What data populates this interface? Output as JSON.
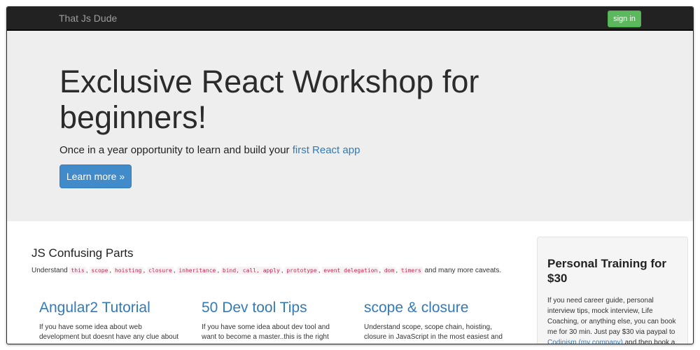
{
  "navbar": {
    "brand": "That Js Dude",
    "signin_label": "sign in"
  },
  "hero": {
    "title": "Exclusive React Workshop for beginners!",
    "subtitle_prefix": "Once in a year opportunity to learn and build your ",
    "subtitle_link": "first React app",
    "button_label": "Learn more »"
  },
  "main": {
    "section_title": "JS Confusing Parts",
    "topics_prefix": "Understand",
    "topics": [
      "this",
      "scope",
      "hoisting",
      "closure",
      "inheritance",
      "bind, call, apply",
      "prototype",
      "event delegation",
      "dom",
      "timers"
    ],
    "topics_separator": ",",
    "topics_suffix": "and many more caveats.",
    "cards": [
      {
        "title": "Angular2 Tutorial",
        "text": "If you have some idea about web development but doesnt have any clue about"
      },
      {
        "title": "50 Dev tool Tips",
        "text": "If you have some idea about dev tool and want to become a master..this is the right"
      },
      {
        "title": "scope & closure",
        "text": "Understand scope, scope chain, hoisting, closure in JavaScript in the most easiest and"
      }
    ]
  },
  "sidebar": {
    "title": "Personal Training for $30",
    "text_before_link": "If you need career guide, personal interview tips, mock interview, Life Coaching, or anything else, you can book me for 30 min. Just pay $30 via paypal to",
    "link1": "Codinism (my company)",
    "text_after_link": "and then book a time slot"
  },
  "colors": {
    "navbar_bg": "#222222",
    "signin_bg": "#5cb85c",
    "primary": "#428bca",
    "link": "#337ab7",
    "code_text": "#c7254e",
    "jumbotron_bg": "#eeeeee"
  }
}
